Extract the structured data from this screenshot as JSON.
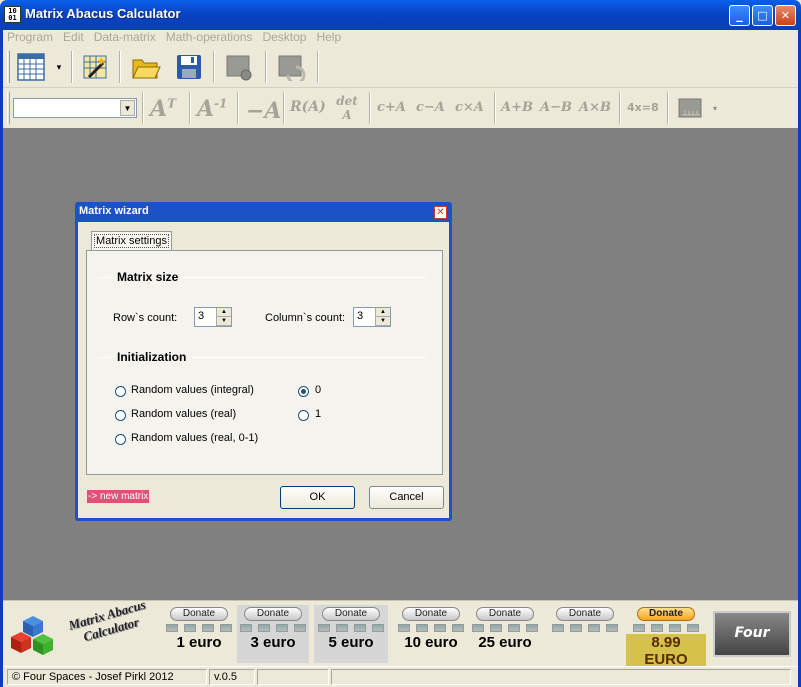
{
  "window": {
    "title": "Matrix Abacus Calculator",
    "app_icon_text": "10\n01",
    "minimize": "_",
    "maximize": "□",
    "close": "✕"
  },
  "menu": [
    "Program",
    "Edit",
    "Data-matrix",
    "Math-operations",
    "Desktop",
    "Help"
  ],
  "toolbar": {
    "new_matrix_dropdown": "▾",
    "combo_value": "",
    "operations": [
      {
        "id": "transpose",
        "label": "A",
        "sup": "T"
      },
      {
        "id": "inverse",
        "label": "A",
        "sup": "-1"
      },
      {
        "id": "negate",
        "label": "−A",
        "sup": ""
      },
      {
        "id": "rank",
        "label": "R(A)",
        "sup": ""
      },
      {
        "id": "determinant",
        "label": "det A",
        "sup": ""
      },
      {
        "id": "add-scalar",
        "label": "c+A",
        "sup": ""
      },
      {
        "id": "subtract-scalar",
        "label": "c−A",
        "sup": ""
      },
      {
        "id": "multiply-scalar",
        "label": "c×A",
        "sup": ""
      },
      {
        "id": "add-matrices",
        "label": "A+B",
        "sup": ""
      },
      {
        "id": "subtract-matrices",
        "label": "A−B",
        "sup": ""
      },
      {
        "id": "multiply-matrices",
        "label": "A×B",
        "sup": ""
      },
      {
        "id": "solve-equation",
        "label": "4x=8",
        "sup": ""
      }
    ]
  },
  "dialog": {
    "title": "Matrix wizard",
    "close": "✕",
    "tab": "Matrix settings",
    "matrix_size": {
      "title": "Matrix size",
      "rows_label": "Row`s count:",
      "rows_value": "3",
      "cols_label": "Column`s count:",
      "cols_value": "3"
    },
    "initialization": {
      "title": "Initialization",
      "options": [
        {
          "label": "Random values (integral)",
          "selected": false
        },
        {
          "label": "Random values (real)",
          "selected": false
        },
        {
          "label": "Random values (real, 0-1)",
          "selected": false
        },
        {
          "label": "0",
          "selected": true
        },
        {
          "label": "1",
          "selected": false
        }
      ]
    },
    "new_matrix_link": "-> new matrix",
    "ok": "OK",
    "cancel": "Cancel"
  },
  "banner": {
    "app_name": "Matrix Abacus Calculator",
    "donate_label": "Donate",
    "donations": [
      "1 euro",
      "3 euro",
      "5 euro",
      "10 euro",
      "25 euro",
      "",
      "8.99 EURO"
    ],
    "brand": "Four spaces"
  },
  "status": {
    "copyright": "© Four Spaces - Josef Pirkl 2012",
    "version": "v.0.5"
  }
}
